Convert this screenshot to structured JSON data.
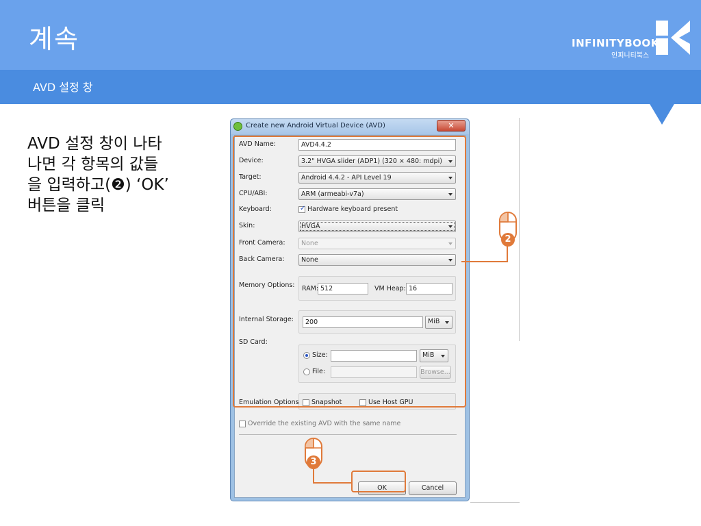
{
  "slide": {
    "title": "계속",
    "subtitle": "AVD 설정 창",
    "brand_name": "INFINITYBOOKS",
    "brand_sub": "인피니티북스",
    "body_line1": "AVD 설정 창이 나타",
    "body_line2": "나면 각 항목의 값들",
    "body_line3_pre": "을 입력하고(",
    "body_line3_badge": "❷",
    "body_line3_post": ") ‘OK’",
    "body_line4": "버튼을 클릭"
  },
  "dialog": {
    "title": "Create new Android Virtual Device (AVD)",
    "close_glyph": "✕",
    "fields": {
      "avd_name": {
        "label": "AVD Name:",
        "value": "AVD4.4.2"
      },
      "device": {
        "label": "Device:",
        "value": "3.2\" HVGA slider (ADP1) (320 × 480: mdpi)"
      },
      "target": {
        "label": "Target:",
        "value": "Android 4.4.2 - API Level 19"
      },
      "cpu_abi": {
        "label": "CPU/ABI:",
        "value": "ARM (armeabi-v7a)"
      },
      "keyboard": {
        "label": "Keyboard:",
        "checkbox_label": "Hardware keyboard present",
        "checked": true
      },
      "skin": {
        "label": "Skin:",
        "value": "HVGA"
      },
      "front_camera": {
        "label": "Front Camera:",
        "value": "None"
      },
      "back_camera": {
        "label": "Back Camera:",
        "value": "None"
      },
      "memory": {
        "label": "Memory Options:",
        "ram_label": "RAM:",
        "ram_value": "512",
        "vm_heap_label": "VM Heap:",
        "vm_heap_value": "16"
      },
      "internal_storage": {
        "label": "Internal Storage:",
        "value": "200",
        "unit": "MiB"
      },
      "sd_card": {
        "label": "SD Card:",
        "size_label": "Size:",
        "size_value": "",
        "size_unit": "MiB",
        "file_label": "File:",
        "file_value": "",
        "browse_label": "Browse..."
      },
      "emulation": {
        "label": "Emulation Options:",
        "snapshot_label": "Snapshot",
        "snapshot_checked": false,
        "host_gpu_label": "Use Host GPU",
        "host_gpu_checked": false
      }
    },
    "override_label": "Override the existing AVD with the same name",
    "override_checked": false,
    "ok_label": "OK",
    "cancel_label": "Cancel"
  },
  "annotations": {
    "step2_badge": "2",
    "step3_badge": "3"
  },
  "colors": {
    "header_blue": "#6aa2ec",
    "subheader_blue": "#4a8ce0",
    "annotation_orange": "#e07a3a"
  }
}
